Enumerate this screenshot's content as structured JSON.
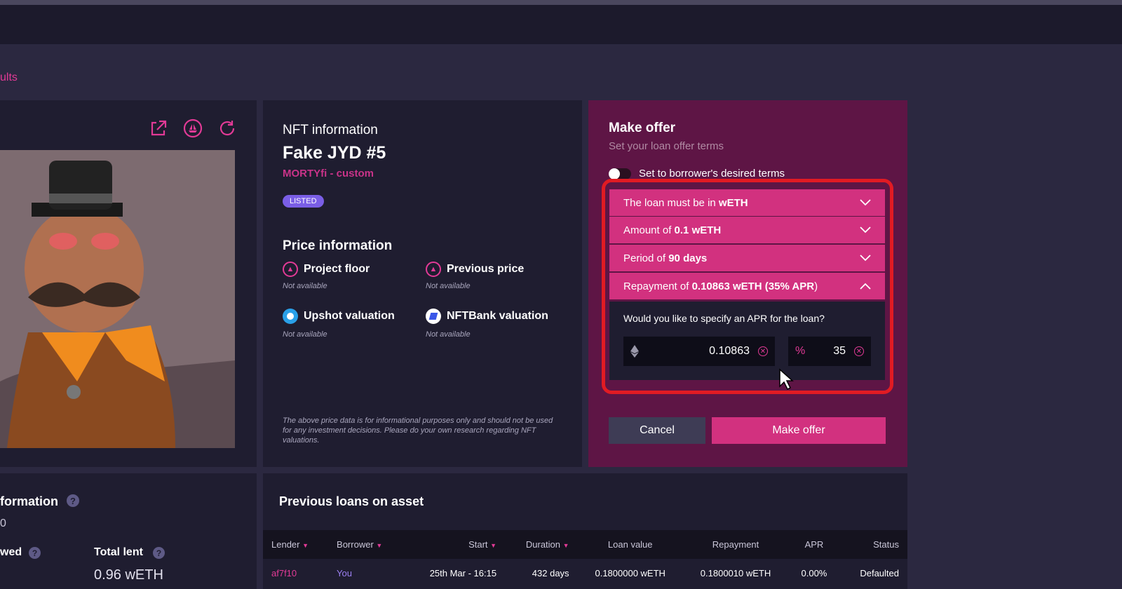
{
  "breadcrumb": "ults",
  "nft_info": {
    "heading": "NFT information",
    "name": "Fake JYD #5",
    "collection": "MORTYfi - custom",
    "badge": "LISTED"
  },
  "price_info": {
    "heading": "Price information",
    "items": [
      {
        "label": "Project floor",
        "value": "Not available",
        "icon": "eth-pink-icon"
      },
      {
        "label": "Previous price",
        "value": "Not available",
        "icon": "eth-pink-icon"
      },
      {
        "label": "Upshot valuation",
        "value": "Not available",
        "icon": "upshot-icon"
      },
      {
        "label": "NFTBank valuation",
        "value": "Not available",
        "icon": "nftbank-icon"
      }
    ],
    "disclaimer": "The above price data is for informational purposes only and should not be used for any investment decisions. Please do your own research regarding NFT valuations."
  },
  "offer": {
    "title": "Make offer",
    "subtitle": "Set your loan offer terms",
    "toggle_label": "Set to borrower's desired terms",
    "rows": [
      {
        "prefix": "The loan must be in ",
        "value": "wETH",
        "suffix": "",
        "chevron": "chevron-down-icon"
      },
      {
        "prefix": "Amount of ",
        "value": "0.1 wETH",
        "suffix": "",
        "chevron": "chevron-down-icon"
      },
      {
        "prefix": "Period of ",
        "value": "90 days",
        "suffix": "",
        "chevron": "chevron-down-icon"
      },
      {
        "prefix": "Repayment of ",
        "value": "0.10863 wETH (35% APR",
        "suffix": ")",
        "chevron": "chevron-up-icon"
      }
    ],
    "apr_question": "Would you like to specify an APR for the loan?",
    "repayment_value": "0.10863",
    "apr_symbol": "%",
    "apr_value": "35",
    "cancel_label": "Cancel",
    "submit_label": "Make offer"
  },
  "lending": {
    "heading": "formation",
    "value_partial": "0",
    "borrowed_label": "wed",
    "total_lent_label": "Total lent",
    "total_lent_value": "0.96 wETH"
  },
  "loans": {
    "heading": "Previous loans on asset",
    "columns": [
      "Lender",
      "Borrower",
      "Start",
      "Duration",
      "Loan value",
      "Repayment",
      "APR",
      "Status"
    ],
    "rows": [
      {
        "lender": "af7f10",
        "borrower": "You",
        "start": "25th Mar - 16:15",
        "duration": "432 days",
        "loan_value": "0.1800000 wETH",
        "repayment": "0.1800010 wETH",
        "apr": "0.00%",
        "status": "Defaulted"
      }
    ]
  },
  "colors": {
    "accent": "#e23a96",
    "offer_bg": "#5e1545",
    "row_pink": "#d2317f",
    "highlight": "#e11b23"
  }
}
